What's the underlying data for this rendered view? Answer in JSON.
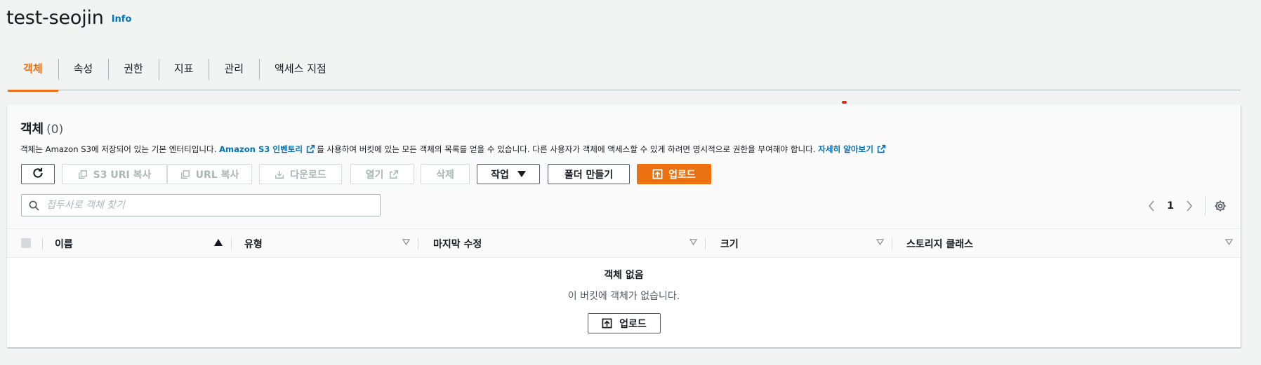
{
  "bucket": {
    "title": "test-seojin",
    "info_link": "Info"
  },
  "tabs": [
    {
      "label": "객체",
      "active": true
    },
    {
      "label": "속성",
      "active": false
    },
    {
      "label": "권한",
      "active": false
    },
    {
      "label": "지표",
      "active": false
    },
    {
      "label": "관리",
      "active": false
    },
    {
      "label": "액세스 지점",
      "active": false
    }
  ],
  "objects_panel": {
    "heading": "객체",
    "count": "(0)",
    "description_prefix": "객체는 Amazon S3에 저장되어 있는 기본 엔터티입니다. ",
    "inventory_link": "Amazon S3 인벤토리",
    "description_middle": "를 사용하여 버킷에 있는 모든 객체의 목록를 얻을 수 있습니다. 다른 사용자가 객체에 액세스할 수 있게 하려면 명시적으로 권한을 부여해야 합니다. ",
    "learn_more_link": "자세히 알아보기"
  },
  "toolbar": {
    "refresh_icon": "refresh-icon",
    "copy_s3_uri": "S3 URI 복사",
    "copy_url": "URL 복사",
    "download": "다운로드",
    "open": "열기",
    "delete": "삭제",
    "actions": "작업",
    "create_folder": "폴더 만들기",
    "upload": "업로드"
  },
  "search": {
    "placeholder": "접두사로 객체 찾기",
    "value": ""
  },
  "pagination": {
    "page": "1"
  },
  "table": {
    "columns": [
      {
        "label": "이름",
        "sort": "ascending"
      },
      {
        "label": "유형",
        "sort": "none"
      },
      {
        "label": "마지막 수정",
        "sort": "none"
      },
      {
        "label": "크기",
        "sort": "none"
      },
      {
        "label": "스토리지 클래스",
        "sort": "none"
      }
    ]
  },
  "empty_state": {
    "title": "객체 없음",
    "message": "이 버킷에 객체가 없습니다.",
    "upload_button": "업로드"
  },
  "colors": {
    "accent": "#ec7211",
    "link": "#0073bb",
    "text": "#16191f",
    "disabled": "#aab7b8",
    "background": "#f2f3f3"
  }
}
